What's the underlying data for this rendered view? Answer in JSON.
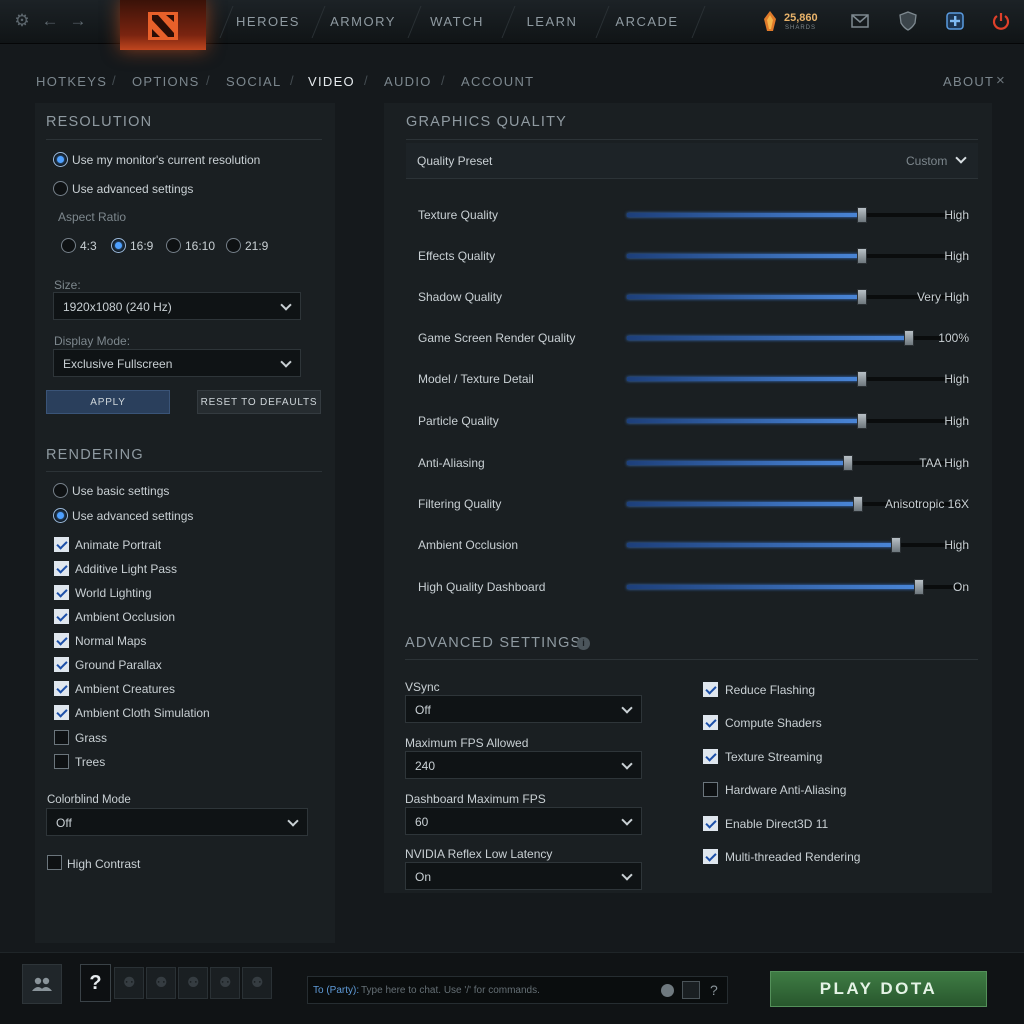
{
  "topbar": {
    "nav": [
      "HEROES",
      "ARMORY",
      "WATCH",
      "LEARN",
      "ARCADE"
    ],
    "shards_count": "25,860",
    "shards_label": "SHARDS"
  },
  "settings_tabs": [
    "HOTKEYS",
    "OPTIONS",
    "SOCIAL",
    "VIDEO",
    "AUDIO",
    "ACCOUNT"
  ],
  "active_tab": "VIDEO",
  "about_label": "ABOUT",
  "resolution": {
    "title": "RESOLUTION",
    "opt_monitor": "Use my monitor's current resolution",
    "opt_advanced": "Use advanced settings",
    "aspect_label": "Aspect Ratio",
    "aspect_options": [
      "4:3",
      "16:9",
      "16:10",
      "21:9"
    ],
    "aspect_selected": "16:9",
    "size_label": "Size:",
    "size_value": "1920x1080 (240 Hz)",
    "display_mode_label": "Display Mode:",
    "display_mode_value": "Exclusive Fullscreen",
    "apply_label": "APPLY",
    "reset_label": "RESET TO DEFAULTS"
  },
  "rendering": {
    "title": "RENDERING",
    "opt_basic": "Use basic settings",
    "opt_advanced": "Use advanced settings",
    "checkboxes": [
      {
        "label": "Animate Portrait",
        "checked": true
      },
      {
        "label": "Additive Light Pass",
        "checked": true
      },
      {
        "label": "World Lighting",
        "checked": true
      },
      {
        "label": "Ambient Occlusion",
        "checked": true
      },
      {
        "label": "Normal Maps",
        "checked": true
      },
      {
        "label": "Ground Parallax",
        "checked": true
      },
      {
        "label": "Ambient Creatures",
        "checked": true
      },
      {
        "label": "Ambient Cloth Simulation",
        "checked": true
      },
      {
        "label": "Grass",
        "checked": false
      },
      {
        "label": "Trees",
        "checked": false
      }
    ],
    "colorblind_label": "Colorblind Mode",
    "colorblind_value": "Off",
    "high_contrast_label": "High Contrast"
  },
  "graphics": {
    "title": "GRAPHICS QUALITY",
    "preset_label": "Quality Preset",
    "preset_value": "Custom",
    "sliders": [
      {
        "label": "Texture Quality",
        "value": "High",
        "level": 0.69
      },
      {
        "label": "Effects Quality",
        "value": "High",
        "level": 0.69
      },
      {
        "label": "Shadow Quality",
        "value": "Very High",
        "level": 0.69
      },
      {
        "label": "Game Screen Render Quality",
        "value": "100%",
        "level": 0.83
      },
      {
        "label": "Model / Texture Detail",
        "value": "High",
        "level": 0.69
      },
      {
        "label": "Particle Quality",
        "value": "High",
        "level": 0.69
      },
      {
        "label": "Anti-Aliasing",
        "value": "TAA High",
        "level": 0.65
      },
      {
        "label": "Filtering Quality",
        "value": "Anisotropic 16X",
        "level": 0.68
      },
      {
        "label": "Ambient Occlusion",
        "value": "High",
        "level": 0.79
      },
      {
        "label": "High Quality Dashboard",
        "value": "On",
        "level": 0.86
      }
    ]
  },
  "advanced": {
    "title": "ADVANCED SETTINGS",
    "dropdowns": [
      {
        "label": "VSync",
        "value": "Off"
      },
      {
        "label": "Maximum FPS Allowed",
        "value": "240"
      },
      {
        "label": "Dashboard Maximum FPS",
        "value": "60"
      },
      {
        "label": "NVIDIA Reflex Low Latency",
        "value": "On"
      }
    ],
    "checkboxes": [
      {
        "label": "Reduce Flashing",
        "checked": true
      },
      {
        "label": "Compute Shaders",
        "checked": true
      },
      {
        "label": "Texture Streaming",
        "checked": true
      },
      {
        "label": "Hardware Anti-Aliasing",
        "checked": false
      },
      {
        "label": "Enable Direct3D 11",
        "checked": true
      },
      {
        "label": "Multi-threaded Rendering",
        "checked": true
      }
    ]
  },
  "bottombar": {
    "help_glyph": "?",
    "chat_target": "To (Party):",
    "chat_placeholder": "Type here to chat. Use '/' for commands.",
    "chat_help": "?",
    "play_label": "PLAY DOTA"
  },
  "colors": {
    "accent_blue": "#4ea0ff",
    "play_green": "#3f7c44",
    "shards_gold": "#e9b36a",
    "power_red": "#e0402a"
  }
}
